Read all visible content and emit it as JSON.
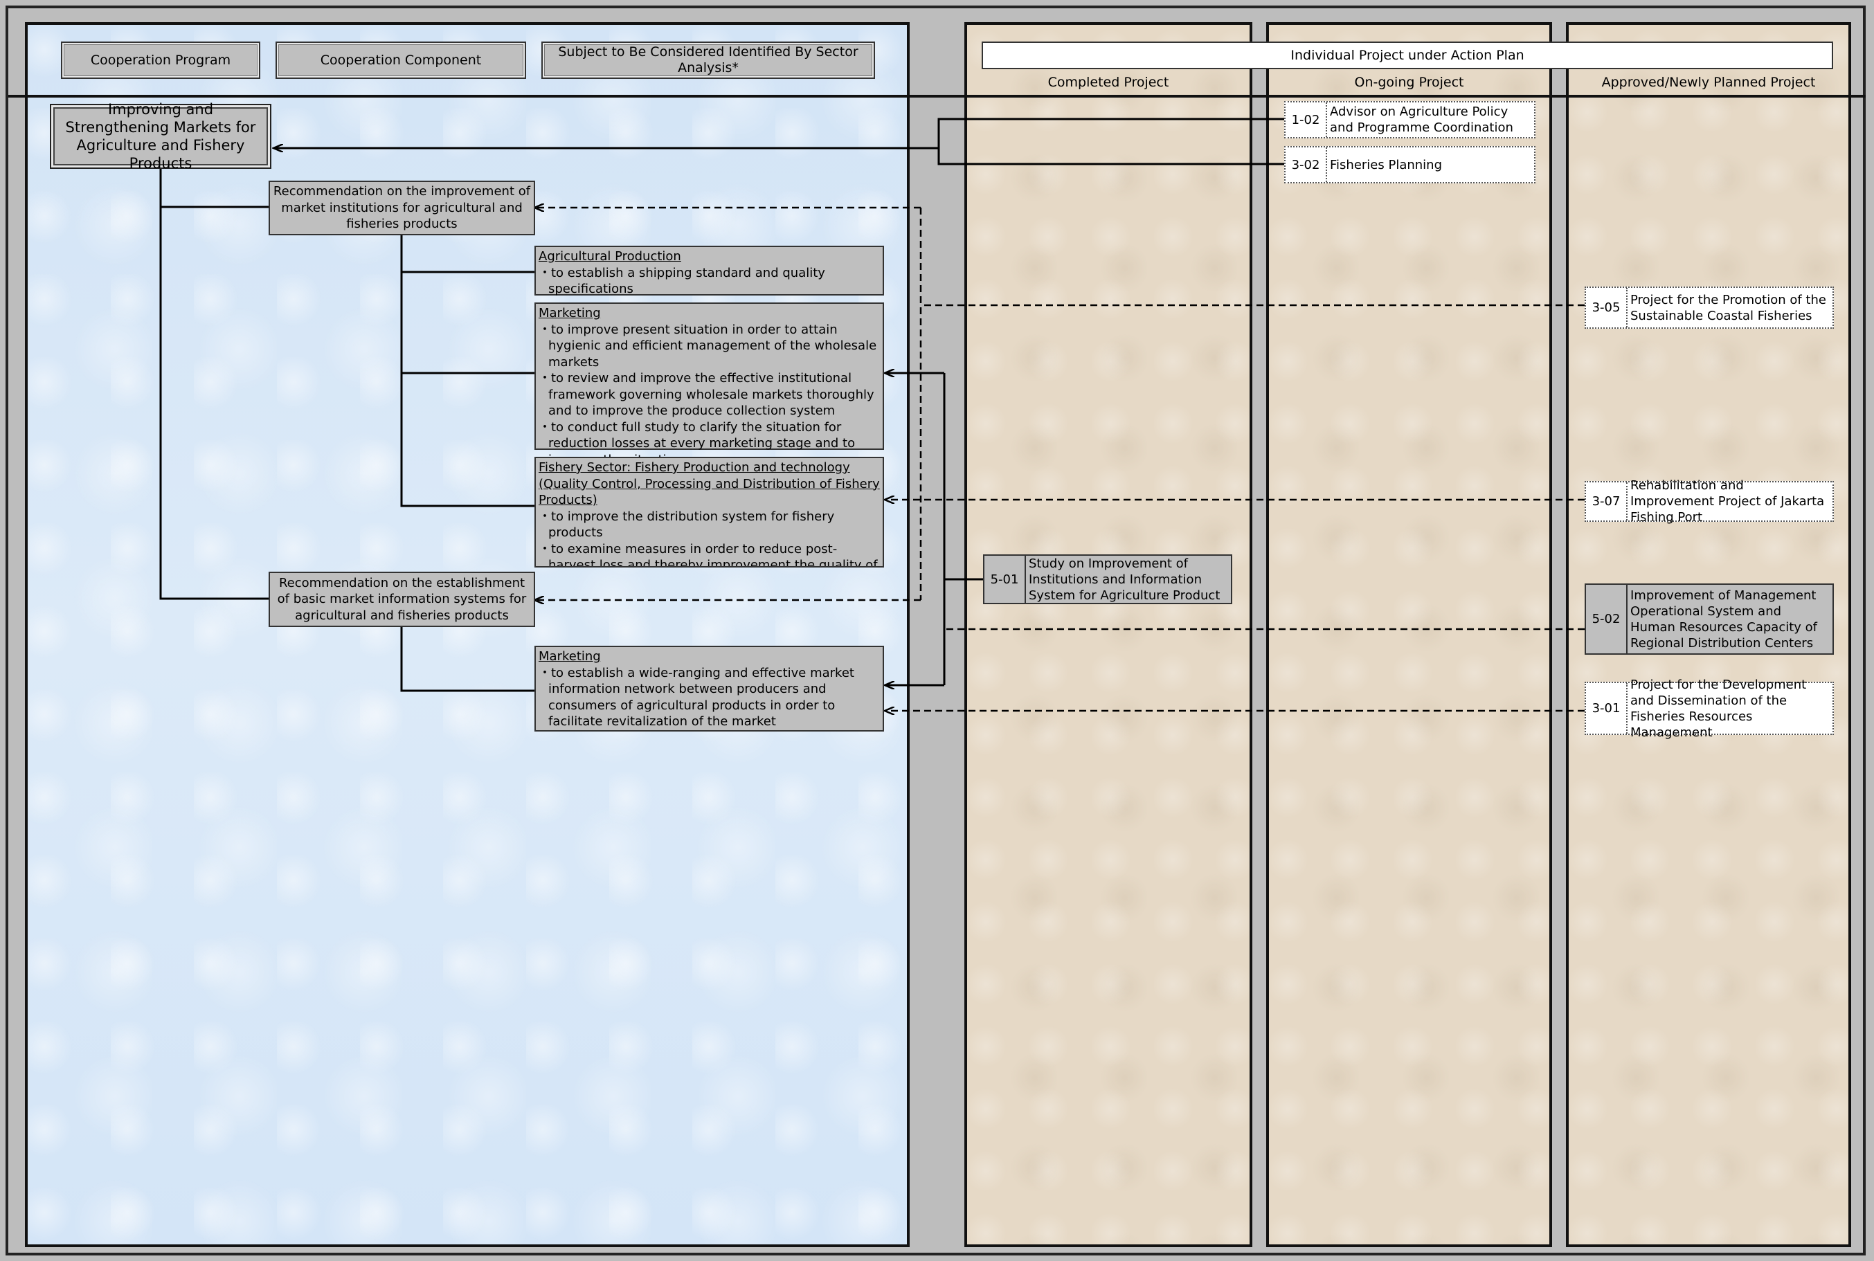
{
  "header": {
    "cooperation_program": "Cooperation Program",
    "cooperation_component": "Cooperation Component",
    "subject": "Subject to Be Considered Identified By Sector Analysis*",
    "individual_project": "Individual Project under Action Plan",
    "completed": "Completed Project",
    "ongoing": "On-going Project",
    "planned": "Approved/Newly Planned Project"
  },
  "program": "Improving and Strengthening Markets for Agriculture and Fishery Products",
  "components": {
    "c1": "Recommendation on the improvement of market institutions for agricultural and fisheries products",
    "c2": "Recommendation on the establishment of basic market information systems for agricultural and fisheries products"
  },
  "subjects": {
    "agri": {
      "title": "Agricultural Production",
      "items": [
        "・to establish a shipping standard and quality specifications"
      ]
    },
    "mkt1": {
      "title": "Marketing",
      "items": [
        "・to improve present situation in order to attain hygienic and efficient management of the wholesale markets",
        "・to review and improve the effective institutional framework governing wholesale markets thoroughly and to improve the produce collection system",
        "・to conduct full study to clarify the situation for reduction  losses at every marketing stage and to improve the situation"
      ]
    },
    "fish": {
      "title": "Fishery Sector: Fishery Production and technology (Quality Control, Processing and Distribution of Fishery Products)",
      "items": [
        "・to improve the distribution system for fishery products",
        "・to examine measures in order to reduce post-harvest loss and thereby improvement the quality of fishery product"
      ]
    },
    "mkt2": {
      "title": "Marketing",
      "items": [
        "・to establish a wide-ranging and effective market information network between producers and consumers of agricultural products in order to facilitate revitalization of the market"
      ]
    }
  },
  "projects": {
    "p501": {
      "code": "5-01",
      "name": "Study on Improvement of Institutions and Information System for Agriculture Product"
    },
    "p102": {
      "code": "1-02",
      "name": "Advisor on Agriculture Policy and Programme Coordination"
    },
    "p302": {
      "code": "3-02",
      "name": "Fisheries Planning"
    },
    "p305": {
      "code": "3-05",
      "name": "Project for the Promotion of the Sustainable Coastal Fisheries"
    },
    "p307": {
      "code": "3-07",
      "name": "Rehabilitation and Improvement Project of Jakarta Fishing Port"
    },
    "p502": {
      "code": "5-02",
      "name": "Improvement of Management Operational System and Human Resources Capacity of Regional Distribution Centers"
    },
    "p301": {
      "code": "3-01",
      "name": "Project for the Development and Dissemination of the Fisheries Resources Management"
    }
  }
}
